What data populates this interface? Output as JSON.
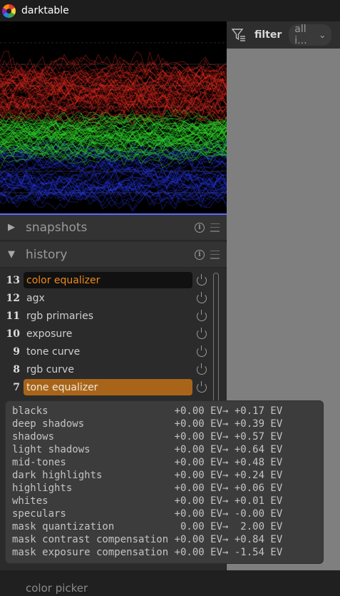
{
  "titlebar": {
    "title": "darktable",
    "icon": "darktable-logo-icon"
  },
  "filter": {
    "label": "filter",
    "dropdown_value": "all i..."
  },
  "modules": {
    "snapshots": {
      "label": "snapshots",
      "expanded": false
    },
    "history": {
      "label": "history",
      "expanded": true
    }
  },
  "history": {
    "items": [
      {
        "num": "13",
        "name": "color equalizer",
        "state": "current"
      },
      {
        "num": "12",
        "name": "agx",
        "state": ""
      },
      {
        "num": "11",
        "name": "rgb primaries",
        "state": ""
      },
      {
        "num": "10",
        "name": "exposure",
        "state": ""
      },
      {
        "num": "9",
        "name": "tone curve",
        "state": ""
      },
      {
        "num": "8",
        "name": "rgb curve",
        "state": ""
      },
      {
        "num": "7",
        "name": "tone equalizer",
        "state": "selected"
      }
    ]
  },
  "tooltip": {
    "rows": [
      {
        "param": "blacks",
        "from": "+0.00 EV",
        "to": "+0.17 EV"
      },
      {
        "param": "deep shadows",
        "from": "+0.00 EV",
        "to": "+0.39 EV"
      },
      {
        "param": "shadows",
        "from": "+0.00 EV",
        "to": "+0.57 EV"
      },
      {
        "param": "light shadows",
        "from": "+0.00 EV",
        "to": "+0.64 EV"
      },
      {
        "param": "mid-tones",
        "from": "+0.00 EV",
        "to": "+0.48 EV"
      },
      {
        "param": "dark highlights",
        "from": "+0.00 EV",
        "to": "+0.24 EV"
      },
      {
        "param": "highlights",
        "from": "+0.00 EV",
        "to": "+0.06 EV"
      },
      {
        "param": "whites",
        "from": "+0.00 EV",
        "to": "+0.01 EV"
      },
      {
        "param": "speculars",
        "from": "+0.00 EV",
        "to": "-0.00 EV"
      },
      {
        "param": "mask quantization",
        "from": " 0.00 EV",
        "to": " 2.00 EV"
      },
      {
        "param": "mask contrast compensation",
        "from": "+0.00 EV",
        "to": "+0.84 EV"
      },
      {
        "param": "mask exposure compensation",
        "from": "+0.00 EV",
        "to": "-1.54 EV"
      }
    ]
  },
  "bottom_module": {
    "label": "color picker"
  },
  "colors": {
    "accent_current": "#f08a1a",
    "accent_selected_bg": "#a8651a",
    "histogram_red": "#e0281e",
    "histogram_green": "#2fd62a",
    "histogram_blue": "#2a3cff"
  }
}
